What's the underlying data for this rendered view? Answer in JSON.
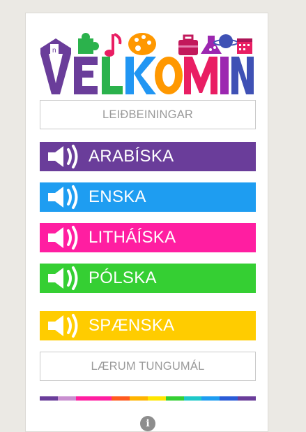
{
  "logo": {
    "letters": [
      "V",
      "E",
      "L",
      "K",
      "O",
      "M",
      "I",
      "N"
    ],
    "colors": [
      "#6a3d9a",
      "#6a3d9a",
      "#2bb24c",
      "#2196f3",
      "#ff9800",
      "#e91e63",
      "#9c27b0",
      "#3f51b5"
    ]
  },
  "guide_button": {
    "label": "LEIÐBEININGAR"
  },
  "languages": [
    {
      "label": "ARABÍSKA",
      "color": "#6a3d9a"
    },
    {
      "label": "ENSKA",
      "color": "#1e9df1"
    },
    {
      "label": "LITHÁÍSKA",
      "color": "#ff1ea1"
    },
    {
      "label": "PÓLSKA",
      "color": "#35cf33"
    },
    {
      "label": "SPÆNSKA",
      "color": "#ffcc00"
    }
  ],
  "learn_button": {
    "label": "LÆRUM TUNGUMÁL"
  },
  "stripe_colors": [
    "#6a3d9a",
    "#c98fd0",
    "#ff1ea1",
    "#ff1ea1",
    "#ff5a1e",
    "#ffb400",
    "#ffe600",
    "#35cf33",
    "#1ec8c8",
    "#1e9df1",
    "#2a5bd7",
    "#6a3d9a"
  ],
  "info_icon": {
    "glyph": "i"
  }
}
